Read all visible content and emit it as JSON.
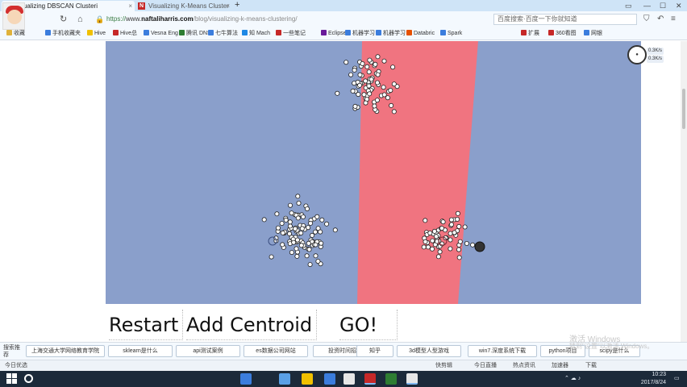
{
  "browser": {
    "tabs": [
      {
        "favicon": "N",
        "label": "Visualizing DBSCAN Clusteri",
        "active": true
      },
      {
        "favicon": "N",
        "label": "Visualizing K-Means Cluster",
        "active": false
      }
    ],
    "new_tab_symbol": "+",
    "address": {
      "scheme": "https://",
      "subdomain": "www.",
      "host": "naftaliharris.com",
      "path": "/blog/visualizing-k-means-clustering/"
    },
    "search_placeholder": "百度搜索·百度一下你就知道",
    "bookmarks": [
      {
        "label": "收藏",
        "color": "#e0b23b"
      },
      {
        "label": "手机收藏夹",
        "color": "#3b7ddd"
      },
      {
        "label": "Hive",
        "color": "#f0c000"
      },
      {
        "label": "Hive总",
        "color": "#c62828"
      },
      {
        "label": "Vesna Eng",
        "color": "#3b7ddd"
      },
      {
        "label": "腾讯 DNS",
        "color": "#2e7d32"
      },
      {
        "label": "七牛算法",
        "color": "#3b7ddd"
      },
      {
        "label": "知 Mach",
        "color": "#1e88e5"
      },
      {
        "label": "一些笔记",
        "color": "#c62828"
      },
      {
        "label": "Eclipse",
        "color": "#6a1b9a"
      },
      {
        "label": "机器学习",
        "color": "#3b7ddd"
      },
      {
        "label": "机器学习",
        "color": "#3b7ddd"
      },
      {
        "label": "Databric",
        "color": "#e65100"
      },
      {
        "label": "Spark",
        "color": "#3b7ddd"
      },
      {
        "label": "扩展",
        "color": "#c62828"
      },
      {
        "label": "360看图",
        "color": "#c62828"
      },
      {
        "label": "网银",
        "color": "#3b7ddd"
      }
    ]
  },
  "app": {
    "buttons": {
      "restart": "Restart",
      "add_centroid": "Add Centroid",
      "go": "GO!"
    },
    "colors": {
      "region_blue": "#8a9fcb",
      "region_red": "#f07480",
      "point_fill": "#ffffff",
      "point_stroke": "#222222"
    }
  },
  "overlay": {
    "speed_lines": [
      "0.3K/s",
      "0.3K/s"
    ]
  },
  "watermark": {
    "line1": "激活 Windows",
    "line2": "转到\"设置\"以激活 Windows。"
  },
  "tag_bar": {
    "label": "搜索推荐",
    "chips": [
      "上海交通大学网络教育学院",
      "sklearn是什么",
      "api测试案例",
      "es数据公司网站",
      "投资时间招聘",
      "知乎",
      "3d模型人型游戏",
      "win7.深度系统下载",
      "python项目",
      "scipy是什么"
    ]
  },
  "status_bar": {
    "left": "今日优选",
    "items": [
      "快剪辑",
      "今日直播",
      "热点资讯",
      "加速器",
      "下载"
    ]
  },
  "taskbar": {
    "time": "10:23",
    "date": "2017/8/24"
  }
}
